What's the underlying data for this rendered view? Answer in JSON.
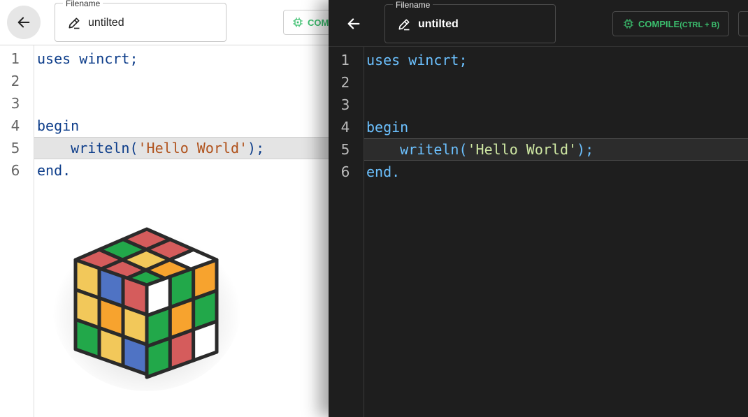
{
  "filename_label": "Filename",
  "filename_value": "untilted",
  "compile_button": {
    "label": "COMPILE",
    "shortcut": "(CTRL + B)"
  },
  "compile_button_light_visible": "COMPI",
  "code_lines": [
    {
      "number": "1",
      "prefix": "uses wincrt;",
      "string": "",
      "suffix": ""
    },
    {
      "number": "2",
      "prefix": "",
      "string": "",
      "suffix": ""
    },
    {
      "number": "3",
      "prefix": "",
      "string": "",
      "suffix": ""
    },
    {
      "number": "4",
      "prefix": "begin",
      "string": "",
      "suffix": ""
    },
    {
      "number": "5",
      "prefix": "    writeln(",
      "string": "'Hello World'",
      "suffix": ");"
    },
    {
      "number": "6",
      "prefix": "end.",
      "string": "",
      "suffix": ""
    }
  ],
  "active_line": 5,
  "icons": [
    "arrow-left-icon",
    "pencil-icon",
    "chip-icon",
    "rubiks-cube-icon"
  ],
  "colors": {
    "light_keyword": "#0d3d8a",
    "light_string": "#b0521c",
    "dark_keyword": "#6cc1ff",
    "dark_string": "#cfe8a3",
    "compile_accent": "#3bbf6e",
    "dark_background": "#1e1e1e"
  }
}
